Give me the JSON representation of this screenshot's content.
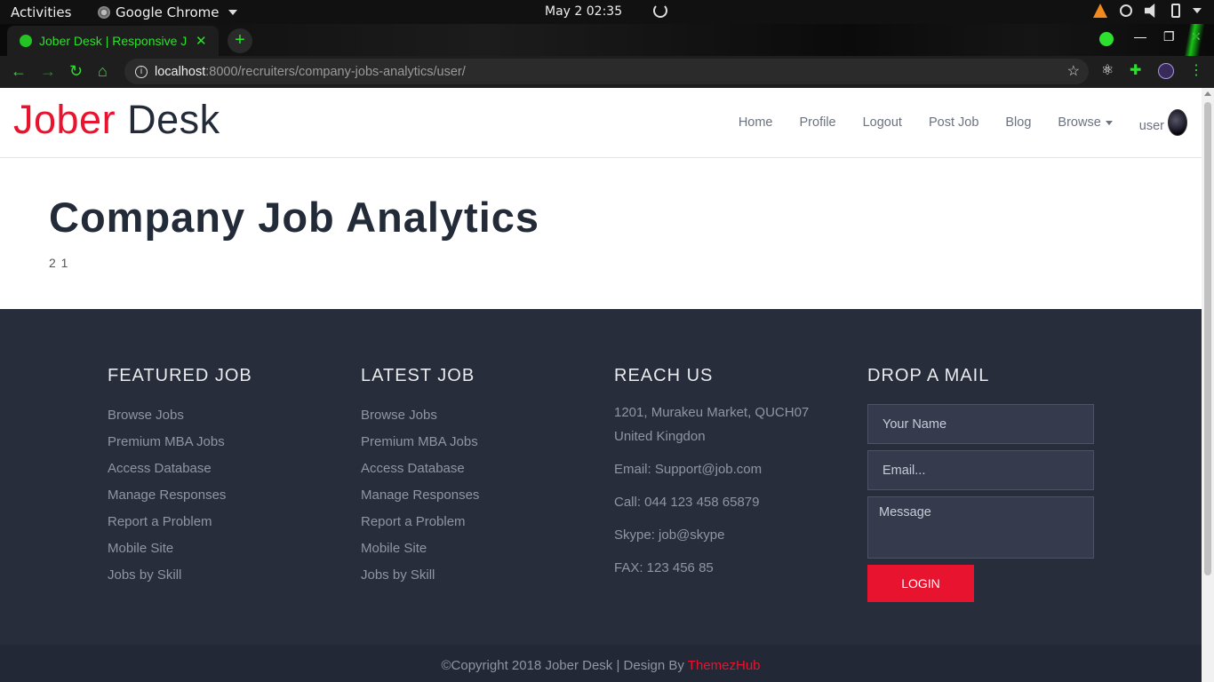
{
  "system": {
    "activities": "Activities",
    "app_name": "Google Chrome",
    "clock": "May 2  02:35"
  },
  "browser": {
    "tab_title": "Jober Desk | Responsive J",
    "new_tab": "+",
    "url_host": "localhost",
    "url_rest": ":8000/recruiters/company-jobs-analytics/user/"
  },
  "header": {
    "logo_part1": "Jober",
    "logo_part2": " Desk",
    "nav": [
      "Home",
      "Profile",
      "Logout",
      "Post Job",
      "Blog"
    ],
    "browse": "Browse",
    "user": "user"
  },
  "main": {
    "title": "Company Job Analytics",
    "values": "2 1"
  },
  "footer": {
    "featured": {
      "heading": "FEATURED JOB",
      "links": [
        "Browse Jobs",
        "Premium MBA Jobs",
        "Access Database",
        "Manage Responses",
        "Report a Problem",
        "Mobile Site",
        "Jobs by Skill"
      ]
    },
    "latest": {
      "heading": "LATEST JOB",
      "links": [
        "Browse Jobs",
        "Premium MBA Jobs",
        "Access Database",
        "Manage Responses",
        "Report a Problem",
        "Mobile Site",
        "Jobs by Skill"
      ]
    },
    "reach": {
      "heading": "REACH US",
      "address1": "1201, Murakeu Market, QUCH07",
      "address2": "United Kingdon",
      "email": "Email: Support@job.com",
      "call": "Call: 044 123 458 65879",
      "skype": "Skype: job@skype",
      "fax": "FAX: 123 456 85"
    },
    "mail": {
      "heading": "DROP A MAIL",
      "name_placeholder": "Your Name",
      "email_placeholder": "Email...",
      "message_placeholder": "Message",
      "button": "LOGIN"
    },
    "copyright_text": "©Copyright 2018 Jober Desk | Design By ",
    "copyright_credit": "ThemezHub"
  },
  "colors": {
    "accent": "#e8132f",
    "dark": "#232a38",
    "footer_bg": "#272d3b"
  }
}
